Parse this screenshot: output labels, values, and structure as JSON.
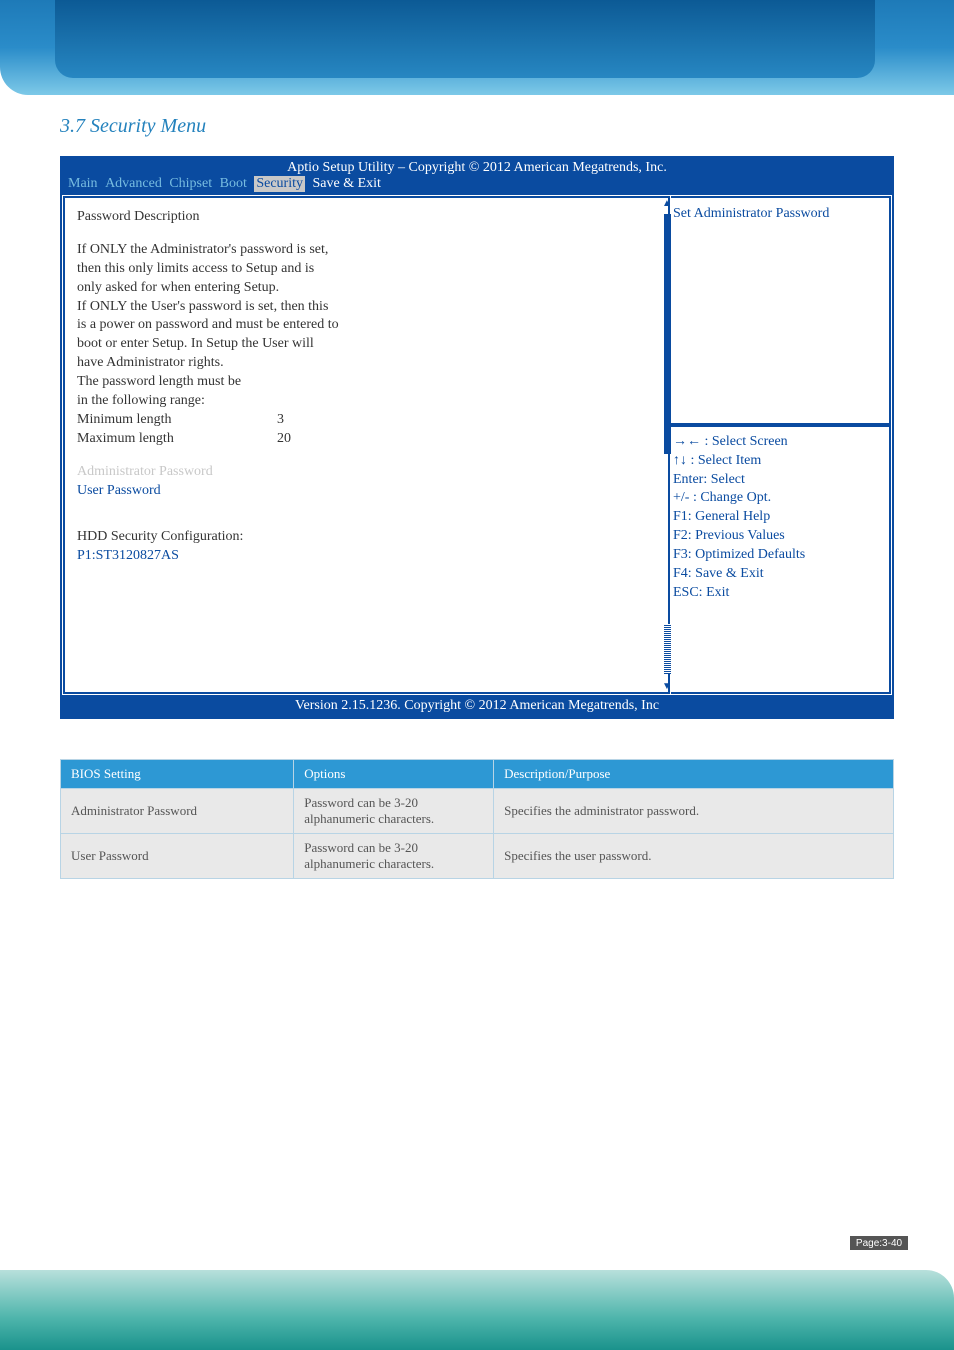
{
  "section_title": "3.7 Security Menu",
  "bios": {
    "header": "Aptio Setup Utility  –  Copyright © 2012 American Megatrends, Inc.",
    "menus": [
      "Main",
      "Advanced",
      "Chipset",
      "Boot",
      "Security",
      "Save & Exit"
    ],
    "selected_menu_index": 4,
    "left": {
      "title": "Password Description",
      "desc": [
        "If ONLY the Administrator's password is set,",
        "then this only limits access to Setup and is",
        "only asked for when entering Setup.",
        "If ONLY the User's password is set, then this",
        "is a power on password and must be entered to",
        "boot or enter Setup. In Setup the User will",
        "have Administrator rights.",
        "The password length must be",
        "in the following range:"
      ],
      "min_label": "Minimum length",
      "min_val": "3",
      "max_label": "Maximum length",
      "max_val": "20",
      "admin_pw": "Administrator Password",
      "user_pw": "User Password",
      "hdd_label": "HDD Security Configuration:",
      "hdd_item": "P1:ST3120827AS"
    },
    "right_top": "Set Administrator Password",
    "help": {
      "l1": "→← : Select Screen",
      "l2": "↑↓ : Select Item",
      "l3": "Enter: Select",
      "l4": "+/- : Change Opt.",
      "l5": "F1: General Help",
      "l6": "F2: Previous Values",
      "l7": "F3: Optimized Defaults",
      "l8": "F4: Save & Exit",
      "l9": "ESC: Exit"
    },
    "footer": "Version 2.15.1236. Copyright © 2012 American Megatrends, Inc"
  },
  "table": {
    "h1": "BIOS Setting",
    "h2": "Options",
    "h3": "Description/Purpose",
    "r1c1": "Administrator Password",
    "r1c2": "Password can be 3-20 alphanumeric characters.",
    "r1c3": "Specifies the administrator password.",
    "r2c1": "User Password",
    "r2c2": "Password can be 3-20 alphanumeric characters.",
    "r2c3": "Specifies the user password."
  },
  "badge": "Page:3-40"
}
